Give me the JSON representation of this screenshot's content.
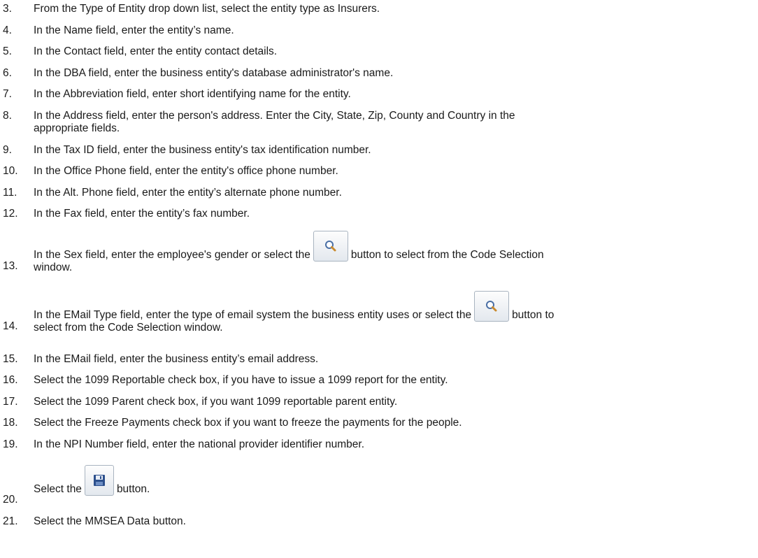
{
  "steps": [
    {
      "num": "3.",
      "text": "From the Type of Entity drop down list, select the entity type as Insurers."
    },
    {
      "num": "4.",
      "text": "In the Name field, enter the entity’s name."
    },
    {
      "num": "5.",
      "text": "In the Contact field, enter the entity contact details."
    },
    {
      "num": "6.",
      "text": "In the DBA field, enter the business entity's database administrator's name."
    },
    {
      "num": "7.",
      "text": "In the Abbreviation field, enter short identifying name for the entity."
    },
    {
      "num": "8.",
      "text_line1": "In the Address field, enter the person's address. Enter the City, State, Zip, County and Country in the",
      "text_line2": "appropriate fields."
    },
    {
      "num": "9.",
      "text": "In the Tax ID field, enter the business entity's tax identification number."
    },
    {
      "num": "10.",
      "text": "In the Office Phone field, enter the entity's office phone number."
    },
    {
      "num": "11.",
      "text": "In the Alt. Phone field, enter the entity’s alternate phone number."
    },
    {
      "num": "12.",
      "text": "In the Fax field, enter the entity’s fax number."
    },
    {
      "num": "13.",
      "text_before": "In the Sex field, enter the employee's gender or select the",
      "text_after": "button to select from the Code Selection",
      "text_line2": "window."
    },
    {
      "num": "14.",
      "text_before": "In the EMail Type field, enter the type of email system the business entity uses or select the",
      "text_after": "button to",
      "text_line2": "select from the Code Selection window."
    },
    {
      "num": "15.",
      "text": "In the EMail field, enter the business entity’s email address."
    },
    {
      "num": "16.",
      "text": "Select the 1099 Reportable check box, if you have to issue a 1099 report for the entity."
    },
    {
      "num": "17.",
      "text": "Select the 1099 Parent check box, if you want 1099 reportable parent entity."
    },
    {
      "num": "18.",
      "text": "Select the Freeze Payments check box if you want to freeze the payments for the people."
    },
    {
      "num": "19.",
      "text": "In the NPI Number field, enter the national provider identifier number."
    },
    {
      "num": "20.",
      "text_before": "Select the",
      "text_after": "button."
    },
    {
      "num": "21.",
      "text": "Select the MMSEA Data button."
    }
  ],
  "icons": {
    "search": "magnifier-icon",
    "save": "floppy-disk-icon"
  }
}
